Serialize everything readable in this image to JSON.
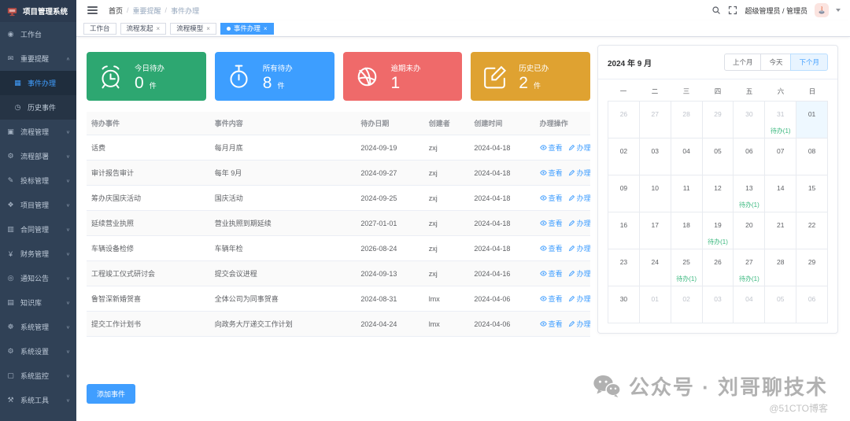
{
  "app": {
    "title": "项目管理系统"
  },
  "sidebar": {
    "items": [
      {
        "label": "工作台",
        "icon": "dashboard-icon"
      },
      {
        "label": "重要提醒",
        "icon": "message-icon",
        "expanded": true,
        "children": [
          {
            "label": "事件办理",
            "icon": "grid-icon",
            "active": true
          },
          {
            "label": "历史事件",
            "icon": "history-icon",
            "active": false
          }
        ]
      },
      {
        "label": "流程管理",
        "icon": "flow-icon",
        "collapsible": true
      },
      {
        "label": "流程部署",
        "icon": "deploy-icon",
        "collapsible": true
      },
      {
        "label": "投标管理",
        "icon": "bid-icon",
        "collapsible": true
      },
      {
        "label": "项目管理",
        "icon": "project-icon",
        "collapsible": true
      },
      {
        "label": "合同管理",
        "icon": "contract-icon",
        "collapsible": true
      },
      {
        "label": "财务管理",
        "icon": "finance-icon",
        "collapsible": true
      },
      {
        "label": "通知公告",
        "icon": "notice-icon",
        "collapsible": true
      },
      {
        "label": "知识库",
        "icon": "knowledge-icon",
        "collapsible": true
      },
      {
        "label": "系统管理",
        "icon": "system-icon",
        "collapsible": true
      },
      {
        "label": "系统设置",
        "icon": "settings-icon",
        "collapsible": true
      },
      {
        "label": "系统监控",
        "icon": "monitor-icon",
        "collapsible": true
      },
      {
        "label": "系统工具",
        "icon": "tools-icon",
        "collapsible": true
      }
    ]
  },
  "header": {
    "breadcrumb": [
      "首页",
      "重要提醒",
      "事件办理"
    ],
    "user_label": "超级管理员 / 管理员"
  },
  "tabs": [
    {
      "label": "工作台",
      "closable": false,
      "active": false
    },
    {
      "label": "流程发起",
      "closable": true,
      "active": false
    },
    {
      "label": "流程模型",
      "closable": true,
      "active": false
    },
    {
      "label": "事件办理",
      "closable": true,
      "active": true
    }
  ],
  "stats": [
    {
      "label": "今日待办",
      "value": "0",
      "unit": "件",
      "color": "#2da771",
      "icon": "alarm-clock-icon"
    },
    {
      "label": "所有待办",
      "value": "8",
      "unit": "件",
      "color": "#3d9eff",
      "icon": "stopwatch-icon"
    },
    {
      "label": "逾期未办",
      "value": "1",
      "unit": "",
      "color": "#ef6a6a",
      "icon": "dribbble-icon"
    },
    {
      "label": "历史已办",
      "value": "2",
      "unit": "件",
      "color": "#dfa231",
      "icon": "edit-square-icon"
    }
  ],
  "table": {
    "columns": [
      "待办事件",
      "事件内容",
      "待办日期",
      "创建者",
      "创建时间",
      "办理操作"
    ],
    "actions": {
      "view": "查看",
      "handle": "办理"
    },
    "rows": [
      {
        "title": "话费",
        "content": "每月月底",
        "due_date": "2024-09-19",
        "due_status": "warning",
        "creator": "zxj",
        "created": "2024-04-18"
      },
      {
        "title": "审计报告审计",
        "content": "每年 9月",
        "due_date": "2024-09-27",
        "due_status": "warning",
        "creator": "zxj",
        "created": "2024-04-18"
      },
      {
        "title": "筹办庆国庆活动",
        "content": "国庆活动",
        "due_date": "2024-09-25",
        "due_status": "warning",
        "creator": "zxj",
        "created": "2024-04-18"
      },
      {
        "title": "延续营业执照",
        "content": "营业执照到期延续",
        "due_date": "2027-01-01",
        "due_status": "warning",
        "creator": "zxj",
        "created": "2024-04-18"
      },
      {
        "title": "车辆设备检修",
        "content": "车辆年检",
        "due_date": "2026-08-24",
        "due_status": "warning",
        "creator": "zxj",
        "created": "2024-04-18"
      },
      {
        "title": "工程竣工仪式研讨会",
        "content": "提交会议进程",
        "due_date": "2024-09-13",
        "due_status": "warning",
        "creator": "zxj",
        "created": "2024-04-16"
      },
      {
        "title": "鲁智深新婚贺喜",
        "content": "全体公司为同事贺喜",
        "due_date": "2024-08-31",
        "due_status": "warning",
        "creator": "lmx",
        "created": "2024-04-06"
      },
      {
        "title": "提交工作计划书",
        "content": "向政务大厅递交工作计划",
        "due_date": "2024-04-24",
        "due_status": "success",
        "creator": "lmx",
        "created": "2024-04-06"
      }
    ]
  },
  "calendar": {
    "title": "2024 年 9 月",
    "buttons": {
      "prev": "上个月",
      "today": "今天",
      "next": "下个月"
    },
    "active_button": "next",
    "weekdays": [
      "一",
      "二",
      "三",
      "四",
      "五",
      "六",
      "日"
    ],
    "cells": [
      {
        "day": "26",
        "muted": true
      },
      {
        "day": "27",
        "muted": true
      },
      {
        "day": "28",
        "muted": true
      },
      {
        "day": "29",
        "muted": true
      },
      {
        "day": "30",
        "muted": true
      },
      {
        "day": "31",
        "muted": true,
        "badge": "待办(1)"
      },
      {
        "day": "01",
        "today": true
      },
      {
        "day": "02"
      },
      {
        "day": "03"
      },
      {
        "day": "04"
      },
      {
        "day": "05"
      },
      {
        "day": "06"
      },
      {
        "day": "07"
      },
      {
        "day": "08"
      },
      {
        "day": "09"
      },
      {
        "day": "10"
      },
      {
        "day": "11"
      },
      {
        "day": "12"
      },
      {
        "day": "13",
        "badge": "待办(1)"
      },
      {
        "day": "14"
      },
      {
        "day": "15"
      },
      {
        "day": "16"
      },
      {
        "day": "17"
      },
      {
        "day": "18"
      },
      {
        "day": "19",
        "badge": "待办(1)"
      },
      {
        "day": "20"
      },
      {
        "day": "21"
      },
      {
        "day": "22"
      },
      {
        "day": "23"
      },
      {
        "day": "24"
      },
      {
        "day": "25",
        "badge": "待办(1)"
      },
      {
        "day": "26"
      },
      {
        "day": "27",
        "badge": "待办(1)"
      },
      {
        "day": "28"
      },
      {
        "day": "29"
      },
      {
        "day": "30"
      },
      {
        "day": "01",
        "muted": true
      },
      {
        "day": "02",
        "muted": true
      },
      {
        "day": "03",
        "muted": true
      },
      {
        "day": "04",
        "muted": true
      },
      {
        "day": "05",
        "muted": true
      },
      {
        "day": "06",
        "muted": true
      }
    ]
  },
  "footer": {
    "add_button": "添加事件"
  },
  "watermark": {
    "text": "公众号 · 刘哥聊技术",
    "handle": "@51CTO博客"
  }
}
